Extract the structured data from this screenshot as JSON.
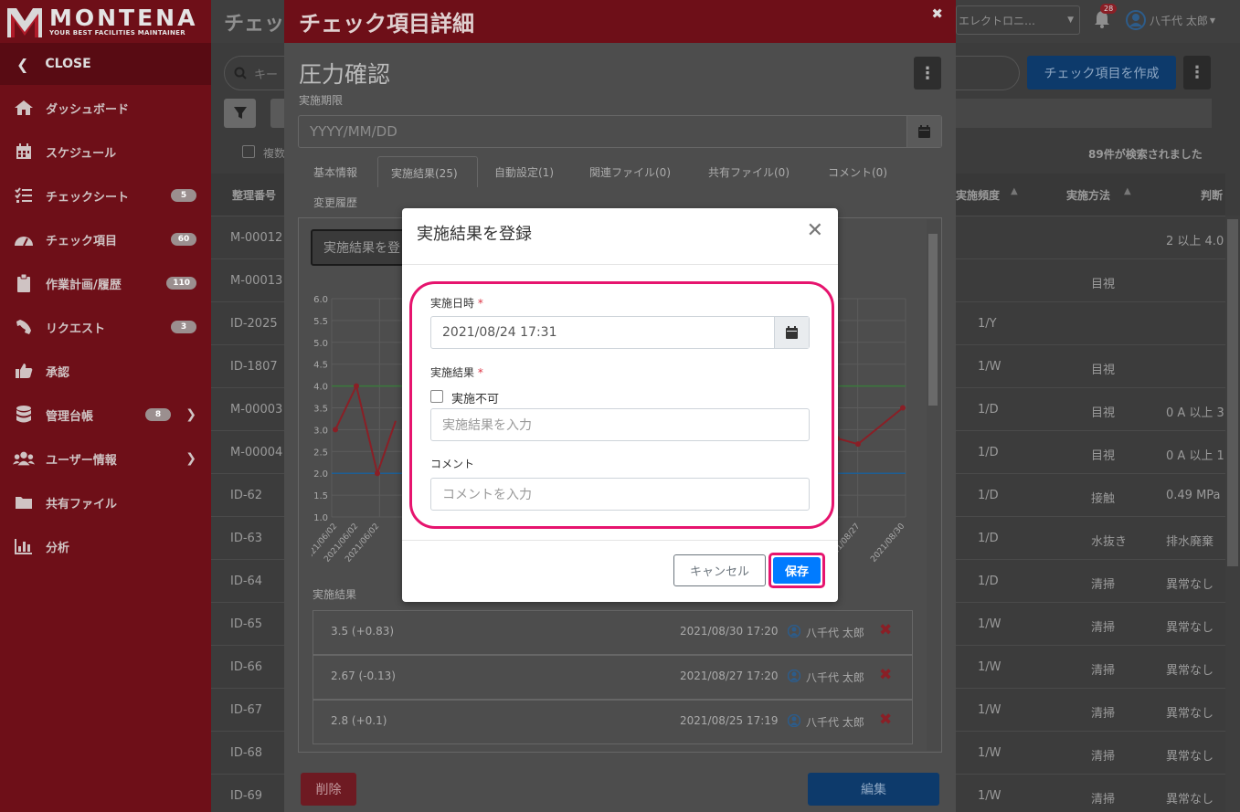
{
  "sidebar": {
    "logo_text": "MONTENA",
    "logo_tagline": "YOUR BEST FACILITIES MAINTAINER",
    "close_label": "CLOSE",
    "items": [
      {
        "label": "ダッシュボード",
        "icon": "home-icon"
      },
      {
        "label": "スケジュール",
        "icon": "calendar-icon"
      },
      {
        "label": "チェックシート",
        "icon": "checklist-icon",
        "badge": "5"
      },
      {
        "label": "チェック項目",
        "icon": "gauge-icon",
        "badge": "60"
      },
      {
        "label": "作業計画/履歴",
        "icon": "clipboard-icon",
        "badge": "110"
      },
      {
        "label": "リクエスト",
        "icon": "phone-icon",
        "badge": "3"
      },
      {
        "label": "承認",
        "icon": "thumbs-up-icon"
      },
      {
        "label": "管理台帳",
        "icon": "database-icon",
        "badge": "8"
      },
      {
        "label": "ユーザー情報",
        "icon": "users-icon"
      },
      {
        "label": "共有ファイル",
        "icon": "folder-icon"
      },
      {
        "label": "分析",
        "icon": "bar-chart-icon"
      }
    ]
  },
  "topbar": {
    "page_title": "チェッ",
    "company_select": "エレクトロニ…",
    "notification_count": "28",
    "user_name": "八千代 太郎"
  },
  "main": {
    "search_placeholder": "キー",
    "create_button": "チェック項目を作成",
    "multi_label": "複数",
    "result_count": "89件が検索されました",
    "headers": {
      "id": "整理番号",
      "frequency": "実施頻度",
      "method": "実施方法",
      "judgement": "判断"
    },
    "rows": [
      {
        "id": "M-00012",
        "freq": "",
        "method": "",
        "judge": "2 以上 4.0"
      },
      {
        "id": "M-00013",
        "freq": "",
        "method": "目視",
        "judge": ""
      },
      {
        "id": "ID-2025",
        "freq": "1/Y",
        "method": "",
        "judge": ""
      },
      {
        "id": "ID-1807",
        "freq": "1/W",
        "method": "目視",
        "judge": ""
      },
      {
        "id": "M-00003",
        "freq": "1/D",
        "method": "目視",
        "judge": "0 A 以上 3"
      },
      {
        "id": "M-00004",
        "freq": "1/D",
        "method": "目視",
        "judge": "0 A 以上 1"
      },
      {
        "id": "ID-62",
        "freq": "1/D",
        "method": "接触",
        "judge": "0.49 MPa"
      },
      {
        "id": "ID-63",
        "freq": "1/D",
        "method": "水抜き",
        "judge": "排水廃棄"
      },
      {
        "id": "ID-64",
        "freq": "1/D",
        "method": "清掃",
        "judge": "異常なし"
      },
      {
        "id": "ID-65",
        "freq": "1/W",
        "method": "清掃",
        "judge": "異常なし"
      },
      {
        "id": "ID-66",
        "freq": "1/W",
        "method": "清掃",
        "judge": "異常なし"
      },
      {
        "id": "ID-67",
        "freq": "1/W",
        "method": "清掃",
        "judge": "異常なし"
      },
      {
        "id": "ID-68",
        "freq": "1/W",
        "method": "清掃",
        "judge": "異常なし"
      },
      {
        "id": "ID-69",
        "freq": "1/W",
        "method": "清掃",
        "judge": "異常なし"
      }
    ]
  },
  "detail": {
    "header_title": "チェック項目詳細",
    "item_title": "圧力確認",
    "deadline_label": "実施期限",
    "deadline_placeholder": "YYYY/MM/DD",
    "tabs": [
      "基本情報",
      "実施結果(25)",
      "自動設定(1)",
      "関連ファイル(0)",
      "共有ファイル(0)",
      "コメント(0)",
      "変更履歴"
    ],
    "register_button": "実施結果を登",
    "results_label": "実施結果",
    "results": [
      {
        "value": "3.5 (+0.83)",
        "date": "2021/08/30 17:20",
        "user": "八千代 太郎"
      },
      {
        "value": "2.67 (-0.13)",
        "date": "2021/08/27 17:20",
        "user": "八千代 太郎"
      },
      {
        "value": "2.8 (+0.1)",
        "date": "2021/08/25 17:19",
        "user": "八千代 太郎"
      }
    ],
    "delete_button": "削除",
    "edit_button": "編集"
  },
  "chart_data": {
    "type": "line",
    "y_ticks": [
      "6.0",
      "5.5",
      "5.0",
      "4.5",
      "4.0",
      "3.5",
      "3.0",
      "2.5",
      "2.0",
      "1.5",
      "1.0"
    ],
    "ylim": [
      1.0,
      6.0
    ],
    "x_labels_left": [
      "2021/06/02",
      "2021/06/02",
      "2021/06/02"
    ],
    "x_labels_right": [
      "2021/08/25",
      "2021/08/27",
      "2021/08/30"
    ],
    "upper_limit": 4.0,
    "lower_limit": 2.0,
    "values_left": [
      3.0,
      4.0,
      2.0
    ],
    "values_right": [
      2.7,
      2.8,
      2.67,
      3.5
    ],
    "colors": {
      "line": "#b8222f",
      "upper": "#4caf50",
      "lower": "#2196f3"
    }
  },
  "dialog": {
    "title": "実施結果を登録",
    "datetime_label": "実施日時",
    "datetime_value": "2021/08/24 17:31",
    "result_label": "実施結果",
    "not_possible_label": "実施不可",
    "result_placeholder": "実施結果を入力",
    "comment_label": "コメント",
    "comment_placeholder": "コメントを入力",
    "cancel_button": "キャンセル",
    "save_button": "保存",
    "required_mark": "*"
  },
  "colors": {
    "brand": "#6e0f18",
    "primary": "#007bff",
    "highlight": "#e6146e",
    "danger": "#dc3545"
  }
}
